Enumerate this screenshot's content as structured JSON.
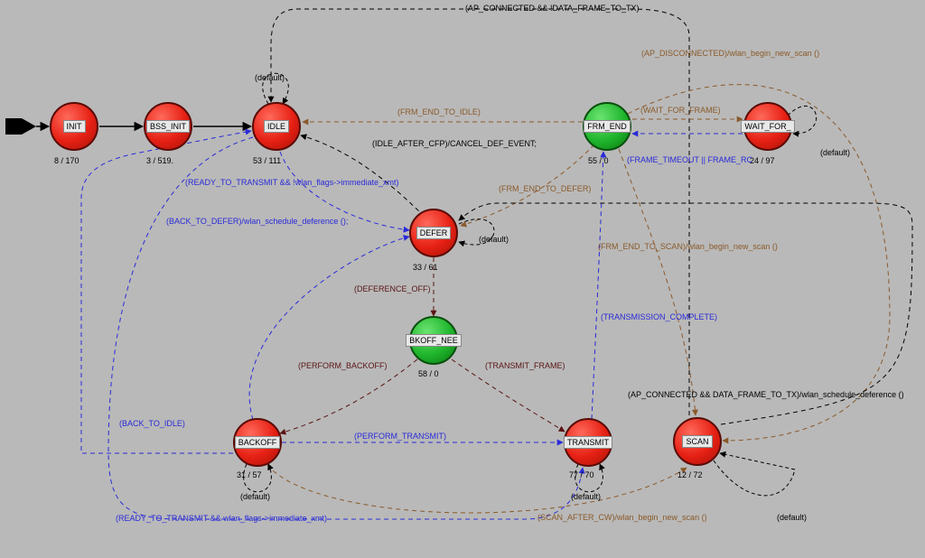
{
  "states": {
    "init": {
      "label": "INIT",
      "info": "8 / 170"
    },
    "bss_init": {
      "label": "BSS_INIT",
      "info": "3 / 519."
    },
    "idle": {
      "label": "IDLE",
      "info": "53 / 111"
    },
    "defer": {
      "label": "DEFER",
      "info": "33 / 61"
    },
    "bkoff": {
      "label": "BKOFF_NEE",
      "info": "58 / 0"
    },
    "backoff": {
      "label": "BACKOFF",
      "info": "31 / 57"
    },
    "transmit": {
      "label": "TRANSMIT",
      "info": "77 / 70"
    },
    "frm_end": {
      "label": "FRM_END",
      "info": "55 / 0"
    },
    "waitfor": {
      "label": "WAIT_FOR_",
      "info": "24 / 97"
    },
    "scan": {
      "label": "SCAN",
      "info": "12 / 72"
    }
  },
  "labels": {
    "default": "(default)",
    "idle_self": "(default)",
    "ap_connected_no_tx": "(AP_CONNECTED && !DATA_FRAME_TO_TX)",
    "ap_disconnected": "(AP_DISCONNECTED)/wlan_begin_new_scan ()",
    "wait_for_frame": "(WAIT_FOR_FRAME)",
    "frame_timeout": "(FRAME_TIMEOUT || FRAME_RC",
    "frm_end_to_idle": "(FRM_END_TO_IDLE)",
    "idle_after_cfp": "(IDLE_AFTER_CFP)/CANCEL_DEF_EVENT;",
    "ready_no_immediate": "(READY_TO_TRANSMIT && !wlan_flags->immediate_xmt)",
    "frm_end_to_defer": "(FRM_END_TO_DEFER)",
    "back_to_defer": "(BACK_TO_DEFER)/wlan_schedule_deference ();",
    "deference_off": "(DEFERENCE_OFF)",
    "frm_end_to_scan": "(FRM_END_TO_SCAN)/wlan_begin_new_scan ()",
    "transmission_complete": "(TRANSMISSION_COMPLETE)",
    "perform_backoff": "(PERFORM_BACKOFF)",
    "transmit_frame": "(TRANSMIT_FRAME)",
    "ap_connected_tx": "(AP_CONNECTED && DATA_FRAME_TO_TX)/wlan_schedule_deference ()",
    "back_to_idle": "(BACK_TO_IDLE)",
    "perform_transmit": "(PERFORM_TRANSMIT)",
    "ready_immediate": "(READY_TO_TRANSMIT && wlan_flags->immediate_xmt)",
    "scan_after_cw": "(SCAN_AFTER_CW)/wlan_begin_new_scan ()"
  },
  "colors": {
    "black": "#000000",
    "blue": "#2a2ad9",
    "brown": "#8a5a2a",
    "dkred": "#5a1414"
  }
}
